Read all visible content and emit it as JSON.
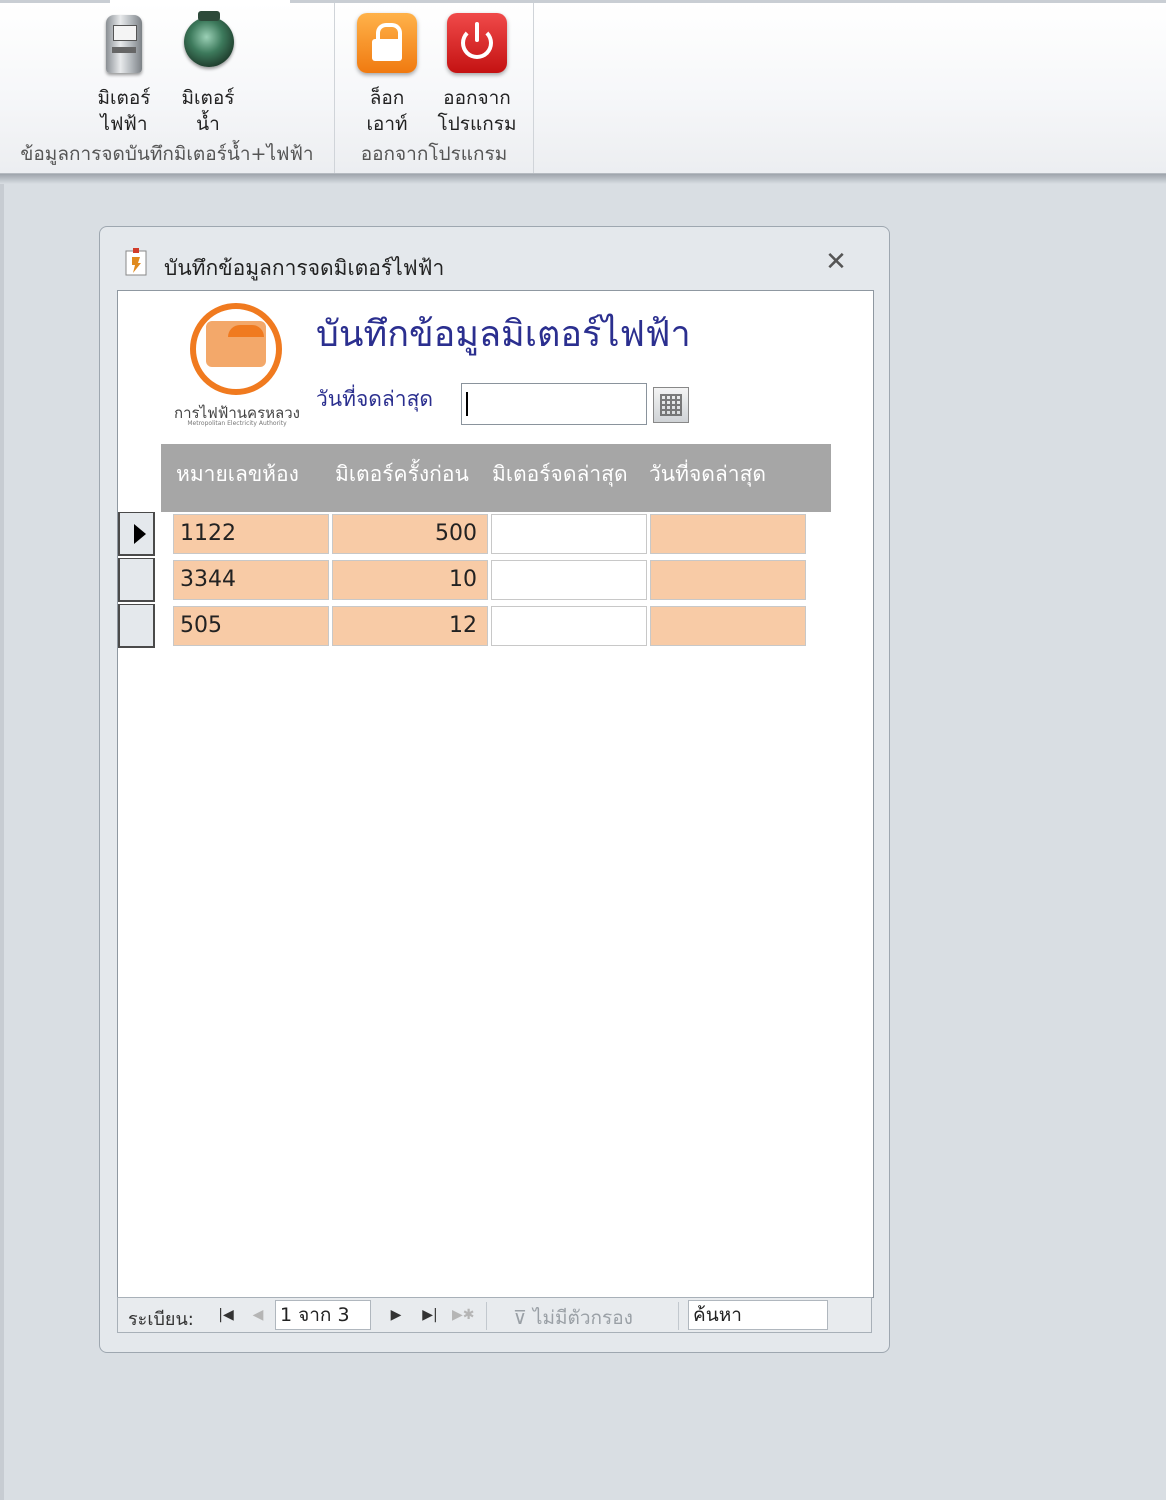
{
  "ribbon": {
    "groups": [
      {
        "label": "ข้อมูลการจดบันทึกมิเตอร์น้ำ+ไฟฟ้า",
        "buttons": [
          {
            "line1": "มิเตอร์",
            "line2": "ไฟฟ้า",
            "icon": "electric-meter-icon"
          },
          {
            "line1": "มิเตอร์",
            "line2": "น้ำ",
            "icon": "water-meter-icon"
          }
        ]
      },
      {
        "label": "ออกจากโปรแกรม",
        "buttons": [
          {
            "line1": "ล็อก",
            "line2": "เอาท์",
            "icon": "lock-icon"
          },
          {
            "line1": "ออกจาก",
            "line2": "โปรแกรม",
            "icon": "power-icon"
          }
        ]
      }
    ]
  },
  "window": {
    "title": "บันทึกข้อมูลการจดมิเตอร์ไฟฟ้า",
    "close_glyph": "✕"
  },
  "form": {
    "heading": "บันทึกข้อมูลมิเตอร์ไฟฟ้า",
    "logo_name": "การไฟฟ้านครหลวง",
    "logo_subtitle": "Metropolitan Electricity Authority",
    "date_label": "วันที่จดล่าสุด",
    "date_value": ""
  },
  "grid": {
    "columns": [
      "หมายเลขห้อง",
      "มิเตอร์ครั้งก่อน",
      "มิเตอร์จดล่าสุด",
      "วันที่จดล่าสุด"
    ],
    "rows": [
      {
        "room": "1122",
        "previous": "500",
        "latest": "",
        "date": ""
      },
      {
        "room": "3344",
        "previous": "10",
        "latest": "",
        "date": ""
      },
      {
        "room": "505",
        "previous": "12",
        "latest": "",
        "date": ""
      }
    ],
    "current_row": 0
  },
  "navigation": {
    "record_label": "ระเบียน:",
    "position": "1 จาก 3",
    "filter_label": "ไม่มีตัวกรอง",
    "search_placeholder": "ค้นหา"
  },
  "colors": {
    "heading": "#2b2f8f",
    "readonly_cell": "#f8cba6",
    "header_bg": "#a6a6a6",
    "logo_orange": "#f07a1f"
  }
}
